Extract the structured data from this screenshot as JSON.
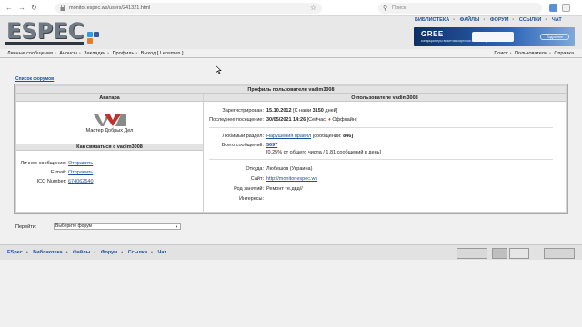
{
  "browser": {
    "url": "monitor.espec.ws/users/241321.html",
    "search_placeholder": "Поиск"
  },
  "site": {
    "logo_text": "ESPEC",
    "top_nav": [
      "БИБЛИОТЕКА",
      "ФАЙЛЫ",
      "ФОРУМ",
      "ССЫЛКИ",
      "ЧАТ"
    ],
    "banner": {
      "brand": "GREE",
      "tagline": "кондиционеры визитная карточка вашего офиса",
      "more": "Подробнее"
    },
    "main_nav_left": [
      "Личные сообщения",
      "Анонсы",
      "Закладки",
      "Профиль",
      "Выход [ Lensmen ]"
    ],
    "main_nav_right": [
      "Поиск",
      "Пользователи",
      "Справка"
    ],
    "forum_list_link": "Список форумов"
  },
  "profile": {
    "title": "Профиль пользователя vadim3008",
    "avatar_header": "Аватара",
    "about_header": "О пользователе vadim3008",
    "avatar_caption": "Мастер Добрых Дел",
    "contact_header": "Как связаться с vadim3008",
    "contacts": [
      {
        "label": "Личное сообщение:",
        "value": "Отправить"
      },
      {
        "label": "E-mail:",
        "value": "Отправить"
      },
      {
        "label": "ICQ Number:",
        "value": "674062640"
      }
    ],
    "registered_label": "Зарегистрирован:",
    "registered_value": "15.10.2012",
    "registered_days_prefix": "[С нами",
    "registered_days": "3150",
    "registered_days_suffix": "дней]",
    "last_visit_label": "Последнее посещение:",
    "last_visit_value": "30/05/2021 14:26",
    "status_prefix": "[Сейчас:",
    "status_value": "Оффлайн]",
    "fav_label": "Любимый раздел:",
    "fav_value": "Нарушения правил",
    "fav_count_prefix": "[сообщений:",
    "fav_count": "846]",
    "total_label": "Всего сообщений:",
    "total_value": "5697",
    "total_note": "[0.25% от общего числа / 1.81 сообщений в день]",
    "from_label": "Откуда:",
    "from_value": "Любешов (Украина)",
    "site_label": "Сайт:",
    "site_value": "http://monitor.espec.ws",
    "occupation_label": "Род занятий:",
    "occupation_value": "Ремонт те.двд//",
    "interests_label": "Интересы:",
    "interests_value": ""
  },
  "jump": {
    "label": "Перейти:",
    "selected": "Выберите форум"
  },
  "footer": {
    "links": [
      "ESpec",
      "Библиотека",
      "Файлы",
      "Форум",
      "Ссылки",
      "Чат"
    ]
  },
  "colors": {
    "link": "#1a4f9c",
    "header_bg": "#e8e8e8",
    "panel_border": "#a9a9a9",
    "banner": "#1c4a92"
  }
}
